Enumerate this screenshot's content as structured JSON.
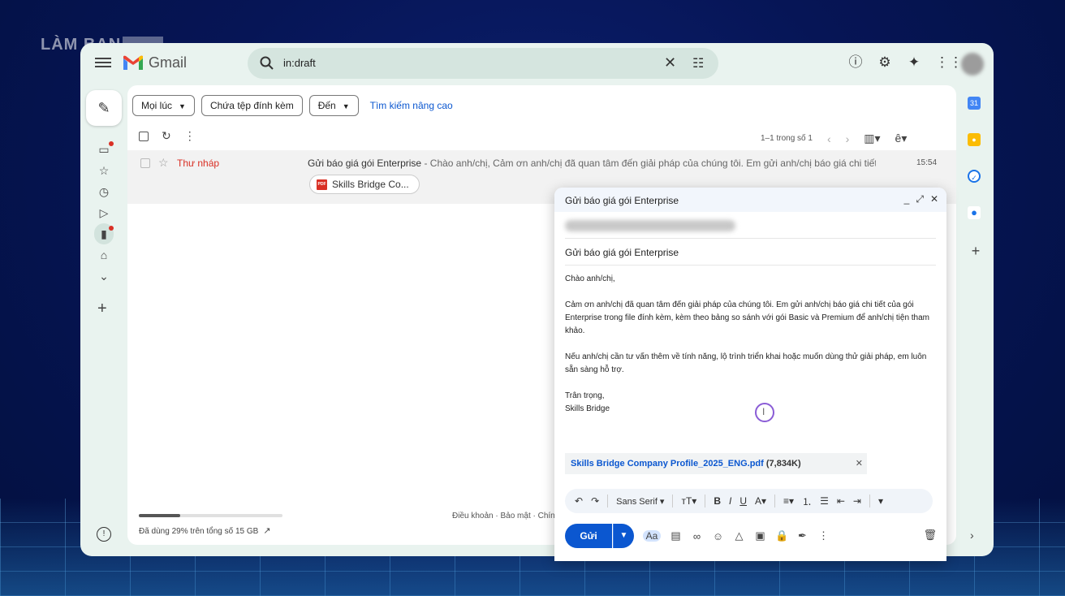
{
  "brand": {
    "logo_text": "LÀM BẠN"
  },
  "app": {
    "name": "Gmail"
  },
  "search": {
    "query": "in:draft"
  },
  "filters": {
    "chips": [
      "Mọi lúc",
      "Chứa tệp đính kèm",
      "Đến"
    ],
    "advanced_link": "Tìm kiếm nâng cao"
  },
  "list": {
    "pagination": "1–1 trong số 1",
    "rows": [
      {
        "sender": "Thư nháp",
        "subject": "Gửi báo giá gói Enterprise",
        "snippet": " - Chào anh/chị, Cảm ơn anh/chị đã quan tâm đến giải pháp của chúng tôi. Em gửi anh/chị báo giá chi tiết của...",
        "time": "15:54",
        "attachment": "Skills Bridge Co..."
      }
    ]
  },
  "storage": {
    "text": "Đã dùng 29% trên tổng số 15 GB",
    "used_fraction": 0.29
  },
  "footer": {
    "links": "Điều khoản · Bảo mật · Chính"
  },
  "compose": {
    "title": "Gửi báo giá gói Enterprise",
    "subject": "Gửi báo giá gói Enterprise",
    "body": {
      "greeting": "Chào anh/chị,",
      "para1": "Cảm ơn anh/chị đã quan tâm đến giải pháp của chúng tôi. Em gửi anh/chị báo giá chi tiết của gói Enterprise trong file đính kèm, kèm theo bảng so sánh với gói Basic và Premium để anh/chị tiện tham khảo.",
      "para2": "Nếu anh/chị cần tư vấn thêm về tính năng, lộ trình triển khai hoặc muốn dùng thử giải pháp, em luôn sẵn sàng hỗ trợ.",
      "closing": "Trân trọng,",
      "signature": "Skills Bridge"
    },
    "attachment": {
      "name": "Skills Bridge Company Profile_2025_ENG.pdf",
      "size": "(7,834K)"
    },
    "font": "Sans Serif",
    "send_label": "Gửi"
  },
  "colors": {
    "accent": "#0b57d0",
    "draft_red": "#d93025",
    "window_bg": "#e9f3ef"
  }
}
